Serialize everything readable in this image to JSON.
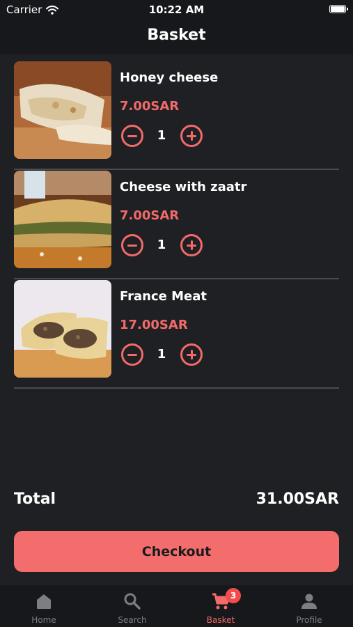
{
  "status_bar": {
    "carrier": "Carrier",
    "time": "10:22 AM"
  },
  "nav": {
    "title": "Basket"
  },
  "items": [
    {
      "name": "Honey cheese",
      "price": "7.00SAR",
      "quantity": "1"
    },
    {
      "name": "Cheese with zaatr",
      "price": "7.00SAR",
      "quantity": "1"
    },
    {
      "name": "France Meat",
      "price": "17.00SAR",
      "quantity": "1"
    }
  ],
  "total": {
    "label": "Total",
    "value": "31.00SAR"
  },
  "checkout": {
    "label": "Checkout"
  },
  "tabs": [
    {
      "label": "Home",
      "icon": "home-icon"
    },
    {
      "label": "Search",
      "icon": "search-icon"
    },
    {
      "label": "Basket",
      "icon": "cart-icon",
      "badge": "3",
      "active": true
    },
    {
      "label": "Profile",
      "icon": "person-icon"
    }
  ],
  "colors": {
    "accent": "#f26a6a",
    "background": "#1f2023",
    "bar": "#17181b",
    "badge": "#f24c4c"
  }
}
